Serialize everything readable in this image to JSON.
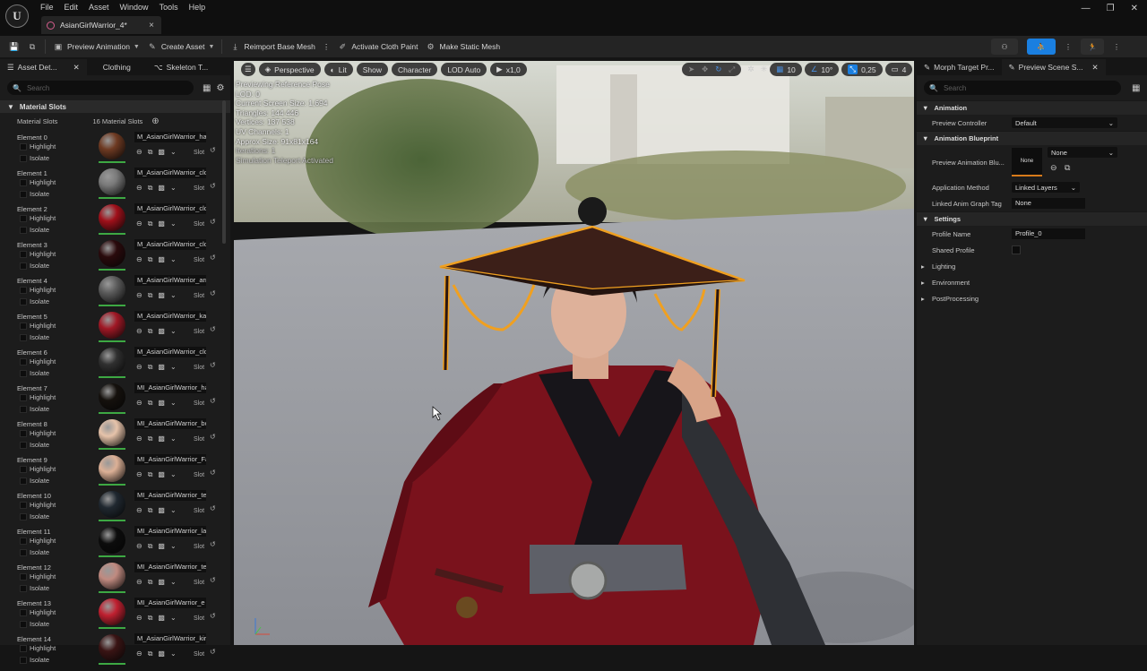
{
  "menu": [
    "File",
    "Edit",
    "Asset",
    "Window",
    "Tools",
    "Help"
  ],
  "document_tab": "AsianGirlWarrior_4*",
  "toolbar": {
    "preview_animation": "Preview Animation",
    "create_asset": "Create Asset",
    "reimport": "Reimport Base Mesh",
    "cloth_paint": "Activate Cloth Paint",
    "static_mesh": "Make Static Mesh"
  },
  "left_tabs": [
    "Asset Det...",
    "Clothing",
    "Skeleton T..."
  ],
  "search_placeholder": "Search",
  "material_slots": {
    "section": "Material Slots",
    "label": "Material Slots",
    "count": "16 Material Slots",
    "highlight_label": "Highlight",
    "isolate_label": "Isolate",
    "slot_label": "Slot",
    "elements": [
      {
        "name": "Element 0",
        "material": "M_AsianGirlWarrior_ha",
        "color": "#6e3a22"
      },
      {
        "name": "Element 1",
        "material": "M_AsianGirlWarrior_clo",
        "color": "#7a7a7a"
      },
      {
        "name": "Element 2",
        "material": "M_AsianGirlWarrior_clo",
        "color": "#a0101a"
      },
      {
        "name": "Element 3",
        "material": "M_AsianGirlWarrior_clo",
        "color": "#2a0a0c"
      },
      {
        "name": "Element 4",
        "material": "M_AsianGirlWarrior_arr",
        "color": "#5c5c5c"
      },
      {
        "name": "Element 5",
        "material": "M_AsianGirlWarrior_ka",
        "color": "#a01825"
      },
      {
        "name": "Element 6",
        "material": "M_AsianGirlWarrior_clo",
        "color": "#303030"
      },
      {
        "name": "Element 7",
        "material": "MI_AsianGirlWarrior_ha",
        "color": "#15110d"
      },
      {
        "name": "Element 8",
        "material": "MI_AsianGirlWarrior_bo",
        "color": "#e6c3aa"
      },
      {
        "name": "Element 9",
        "material": "MI_AsianGirlWarrior_Fa",
        "color": "#dcb096"
      },
      {
        "name": "Element 10",
        "material": "MI_AsianGirlWarrior_te",
        "color": "#202830"
      },
      {
        "name": "Element 11",
        "material": "MI_AsianGirlWarrior_la",
        "color": "#0c0c0c"
      },
      {
        "name": "Element 12",
        "material": "MI_AsianGirlWarrior_te",
        "color": "#c08a80"
      },
      {
        "name": "Element 13",
        "material": "MI_AsianGirlWarrior_e",
        "color": "#c02030"
      },
      {
        "name": "Element 14",
        "material": "M_AsianGirlWarrior_kir",
        "color": "#3a1414"
      }
    ]
  },
  "viewport": {
    "perspective": "Perspective",
    "lit": "Lit",
    "show": "Show",
    "character": "Character",
    "lod": "LOD Auto",
    "play_rate": "x1,0",
    "grid_value": "10",
    "angle_value": "10°",
    "scale_value": "0,25",
    "camera_value": "4",
    "stats": [
      "Previewing Reference Pose",
      "LOD: 0",
      "Current Screen Size: 1,694",
      "Triangles: 144 446",
      "Vertices: 137 538",
      "UV Channels: 1",
      "Approx Size: 91x81x164",
      "Iterations: 1",
      "Simulation Teleport Activated"
    ]
  },
  "right_tabs": [
    "Morph Target Pr...",
    "Preview Scene S..."
  ],
  "right_panel": {
    "animation_section": "Animation",
    "preview_controller_label": "Preview Controller",
    "preview_controller_value": "Default",
    "blueprint_section": "Animation Blueprint",
    "preview_bp_label": "Preview Animation Blu...",
    "preview_bp_thumb": "None",
    "preview_bp_value": "None",
    "app_method_label": "Application Method",
    "app_method_value": "Linked Layers",
    "linked_tag_label": "Linked Anim Graph Tag",
    "linked_tag_value": "None",
    "settings_section": "Settings",
    "profile_name_label": "Profile Name",
    "profile_name_value": "Profile_0",
    "shared_profile_label": "Shared Profile",
    "lighting": "Lighting",
    "environment": "Environment",
    "postprocessing": "PostProcessing"
  }
}
